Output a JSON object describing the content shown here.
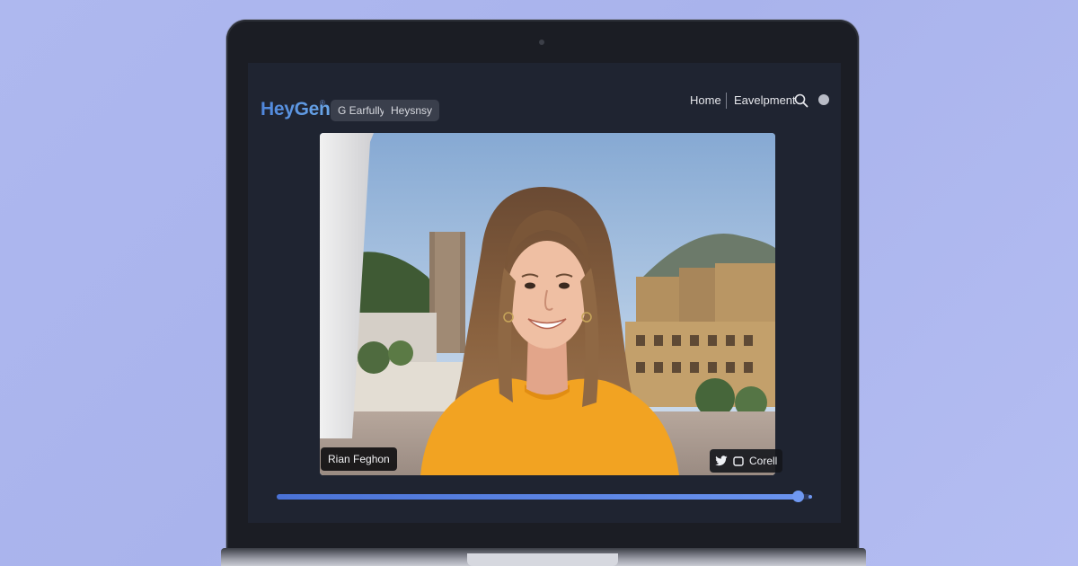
{
  "app": {
    "brand": "HeyGen",
    "brand_mark": "®",
    "chips": [
      "G Earfully",
      "Heysnsy"
    ],
    "nav": {
      "home": "Home",
      "development": "Eavelpment"
    }
  },
  "video": {
    "presenter_name": "Rian Feghon",
    "share_label": "Corell",
    "progress_fraction": 0.977
  },
  "icons": {
    "search": "search-icon",
    "avatar": "avatar-icon",
    "twitter": "twitter-icon",
    "copy": "copy-icon"
  },
  "colors": {
    "background": "#aeb8ef",
    "screen": "#1f2431",
    "brand": "#5b8fe0",
    "progress": "#5b84e4",
    "shirt": "#f2a322"
  }
}
